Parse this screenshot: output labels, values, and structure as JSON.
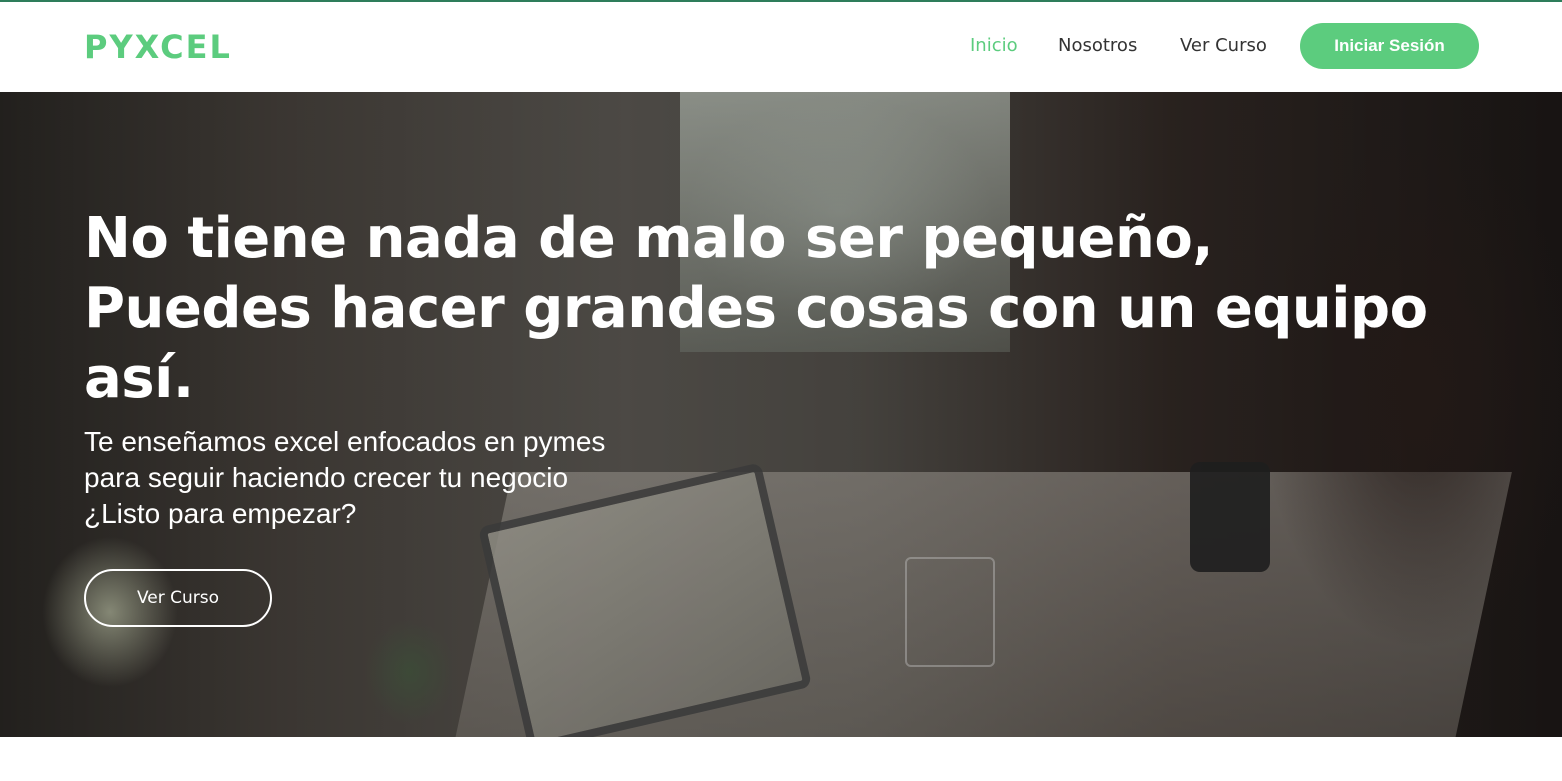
{
  "brand": {
    "logo": "PYXCEL",
    "accent_color": "#5ccc7e"
  },
  "nav": {
    "items": [
      {
        "label": "Inicio",
        "active": true
      },
      {
        "label": "Nosotros",
        "active": false
      },
      {
        "label": "Ver Curso",
        "active": false
      }
    ],
    "login_label": "Iniciar Sesión"
  },
  "hero": {
    "title_lines": [
      "No tiene nada de malo ser pequeño,",
      "Puedes hacer grandes cosas con un equipo",
      "así."
    ],
    "subtitle_lines": [
      "Te enseñamos excel enfocados en pymes",
      "para seguir haciendo crecer tu negocio",
      "¿Listo para empezar?"
    ],
    "cta_label": "Ver Curso"
  }
}
